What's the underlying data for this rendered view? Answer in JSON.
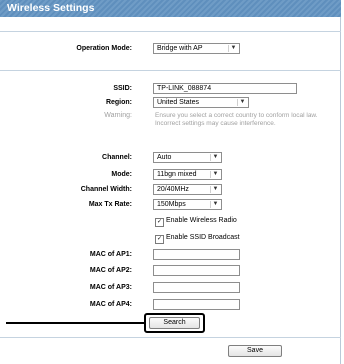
{
  "page": {
    "title": "Wireless Settings"
  },
  "form": {
    "operation_mode": {
      "label": "Operation Mode:",
      "value": "Bridge with AP"
    },
    "ssid": {
      "label": "SSID:",
      "value": "TP-LINK_088874"
    },
    "region": {
      "label": "Region:",
      "value": "United States"
    },
    "warning": {
      "label": "Warning:",
      "line1": "Ensure you select a correct country to conform local law.",
      "line2": "Incorrect settings may cause interference."
    },
    "channel": {
      "label": "Channel:",
      "value": "Auto"
    },
    "mode": {
      "label": "Mode:",
      "value": "11bgn mixed"
    },
    "channel_width": {
      "label": "Channel Width:",
      "value": "20/40MHz"
    },
    "max_tx_rate": {
      "label": "Max Tx Rate:",
      "value": "150Mbps"
    },
    "enable_wireless_radio": {
      "label": "Enable Wireless Radio",
      "checked": true
    },
    "enable_ssid_broadcast": {
      "label": "Enable SSID Broadcast",
      "checked": true
    },
    "mac_ap1": {
      "label": "MAC of AP1:",
      "value": ""
    },
    "mac_ap2": {
      "label": "MAC of AP2:",
      "value": ""
    },
    "mac_ap3": {
      "label": "MAC of AP3:",
      "value": ""
    },
    "mac_ap4": {
      "label": "MAC of AP4:",
      "value": ""
    }
  },
  "buttons": {
    "search_label": "Search",
    "save_label": "Save"
  },
  "icons": {
    "dropdown": "chevron-down-icon",
    "checkmark": "check-icon"
  },
  "colors": {
    "title_bar": "#6f9cc6",
    "warning_text": "#a0a0a0",
    "rule": "#c5d3e0"
  }
}
